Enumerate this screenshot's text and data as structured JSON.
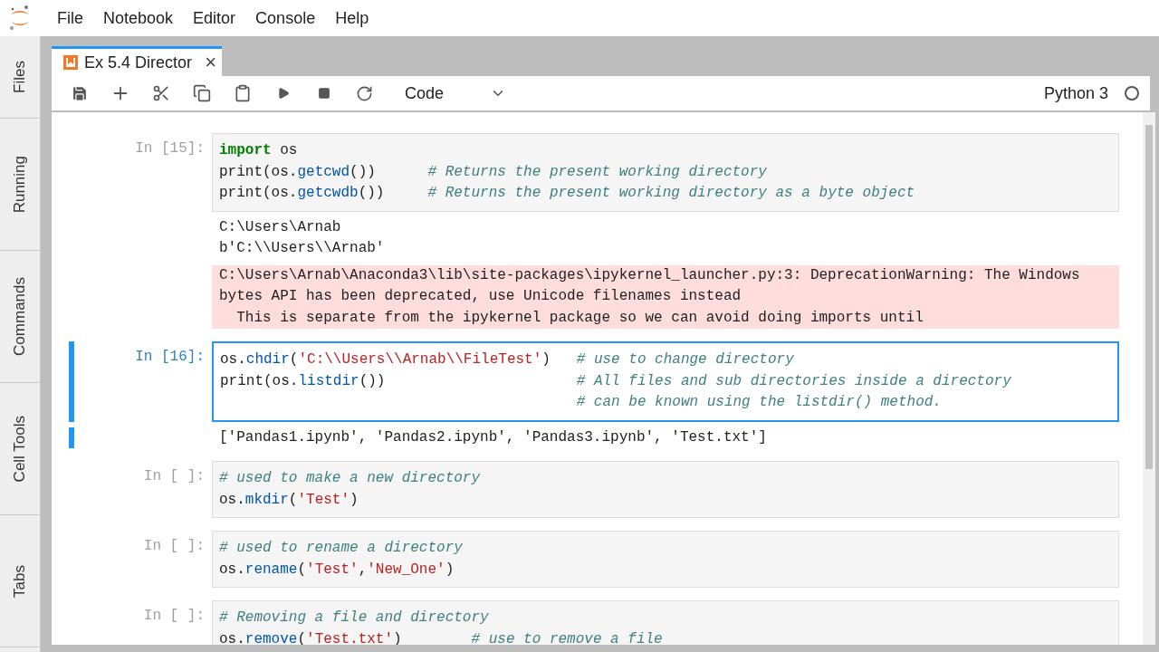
{
  "menu": [
    "File",
    "Notebook",
    "Editor",
    "Console",
    "Help"
  ],
  "sidebar_tabs": [
    "Files",
    "Running",
    "Commands",
    "Cell Tools",
    "Tabs"
  ],
  "tabs": [
    {
      "label": "Ex 5.4 Director",
      "selected": true,
      "close": "×"
    }
  ],
  "toolbar": {
    "cell_type": "Code",
    "kernel": "Python 3",
    "kernel_busy": false
  },
  "cells": [
    {
      "prompt": "In [15]:",
      "selected": false,
      "input": [
        [
          {
            "kind": "keyword",
            "text": "import"
          },
          {
            "kind": "plain",
            "text": " os"
          }
        ],
        [
          {
            "kind": "plain",
            "text": "print(os."
          },
          {
            "kind": "func",
            "text": "getcwd"
          },
          {
            "kind": "plain",
            "text": "())      "
          },
          {
            "kind": "comment",
            "text": "# Returns the present working directory"
          }
        ],
        [
          {
            "kind": "plain",
            "text": "print(os."
          },
          {
            "kind": "func",
            "text": "getcwdb"
          },
          {
            "kind": "plain",
            "text": "())     "
          },
          {
            "kind": "comment",
            "text": "# Returns the present working directory as a byte object"
          }
        ]
      ],
      "outputs": [
        {
          "kind": "stdout",
          "lines": [
            "C:\\Users\\Arnab",
            "b'C:\\\\Users\\\\Arnab'"
          ]
        },
        {
          "kind": "stderr",
          "lines": [
            "C:\\Users\\Arnab\\Anaconda3\\lib\\site-packages\\ipykernel_launcher.py:3: DeprecationWarning: The Windows",
            "bytes API has been deprecated, use Unicode filenames instead",
            "  This is separate from the ipykernel package so we can avoid doing imports until"
          ]
        }
      ]
    },
    {
      "prompt": "In [16]:",
      "selected": true,
      "input": [
        [
          {
            "kind": "plain",
            "text": "os."
          },
          {
            "kind": "func",
            "text": "chdir"
          },
          {
            "kind": "plain",
            "text": "("
          },
          {
            "kind": "string",
            "text": "'C:\\\\Users\\\\Arnab\\\\FileTest'"
          },
          {
            "kind": "plain",
            "text": ")   "
          },
          {
            "kind": "comment",
            "text": "# use to change directory"
          }
        ],
        [
          {
            "kind": "plain",
            "text": "print(os."
          },
          {
            "kind": "func",
            "text": "listdir"
          },
          {
            "kind": "plain",
            "text": "())                      "
          },
          {
            "kind": "comment",
            "text": "# All files and sub directories inside a directory"
          }
        ],
        [
          {
            "kind": "comment",
            "text": "                                         # can be known using the listdir() method."
          }
        ]
      ],
      "outputs": [
        {
          "kind": "stdout",
          "lines": [
            "['Pandas1.ipynb', 'Pandas2.ipynb', 'Pandas3.ipynb', 'Test.txt']"
          ]
        }
      ]
    },
    {
      "prompt": "In [ ]:",
      "selected": false,
      "input": [
        [
          {
            "kind": "comment",
            "text": "# used to make a new directory"
          }
        ],
        [
          {
            "kind": "plain",
            "text": "os."
          },
          {
            "kind": "func",
            "text": "mkdir"
          },
          {
            "kind": "plain",
            "text": "("
          },
          {
            "kind": "string",
            "text": "'Test'"
          },
          {
            "kind": "plain",
            "text": ")"
          }
        ]
      ]
    },
    {
      "prompt": "In [ ]:",
      "selected": false,
      "input": [
        [
          {
            "kind": "comment",
            "text": "# used to rename a directory"
          }
        ],
        [
          {
            "kind": "plain",
            "text": "os."
          },
          {
            "kind": "func",
            "text": "rename"
          },
          {
            "kind": "plain",
            "text": "("
          },
          {
            "kind": "string",
            "text": "'Test'"
          },
          {
            "kind": "plain",
            "text": ","
          },
          {
            "kind": "string",
            "text": "'New_One'"
          },
          {
            "kind": "plain",
            "text": ")"
          }
        ]
      ]
    },
    {
      "prompt": "In [ ]:",
      "selected": false,
      "input": [
        [
          {
            "kind": "comment",
            "text": "# Removing a file and directory"
          }
        ],
        [
          {
            "kind": "plain",
            "text": "os."
          },
          {
            "kind": "func",
            "text": "remove"
          },
          {
            "kind": "plain",
            "text": "("
          },
          {
            "kind": "string",
            "text": "'Test.txt'"
          },
          {
            "kind": "plain",
            "text": ")        "
          },
          {
            "kind": "comment",
            "text": "# use to remove a file"
          }
        ]
      ]
    }
  ]
}
